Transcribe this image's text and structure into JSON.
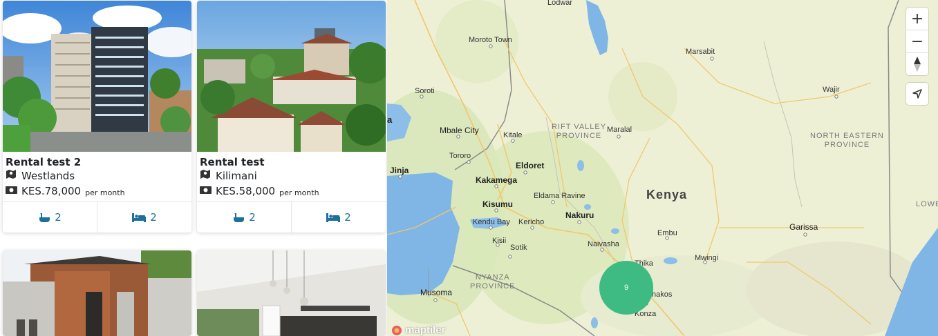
{
  "listings": [
    {
      "title": "Rental test 2",
      "location": "Westlands",
      "price": "KES.78,000",
      "period": "per month",
      "bathrooms": "2",
      "bedrooms": "2"
    },
    {
      "title": "Rental test",
      "location": "Kilimani",
      "price": "KES.58,000",
      "period": "per month",
      "bathrooms": "2",
      "bedrooms": "2"
    }
  ],
  "map": {
    "labels": {
      "lodwar": "Lodwar",
      "moroto": "Moroto Town",
      "marsabit": "Marsabit",
      "soroti": "Soroti",
      "wajir": "Wajir",
      "mbale": "Mbale City",
      "kitale": "Kitale",
      "maralal": "Maralal",
      "rift": "RIFT VALLEY",
      "rift2": "PROVINCE",
      "ne": "NORTH EASTERN",
      "ne2": "PROVINCE",
      "tororo": "Tororo",
      "jinja": "Jinja",
      "eldoret": "Eldoret",
      "kakamega": "Kakamega",
      "eldama": "Eldama Ravine",
      "kenya": "Kenya",
      "lowe": "LOWE",
      "kisumu": "Kisumu",
      "kendu": "Kendu Bay",
      "kericho": "Kericho",
      "nakuru": "Nakuru",
      "garissa": "Garissa",
      "embu": "Embu",
      "kisii": "Kisii",
      "sotik": "Sotik",
      "naivasha": "Naivasha",
      "thika": "Thika",
      "mwingi": "Mwingi",
      "nyanza": "NYANZA",
      "nyanza2": "PROVINCE",
      "musoma": "Musoma",
      "machakos": "hakos",
      "konza": "Konza",
      "ja": "a"
    },
    "cluster_count": "9",
    "attribution": "maptiler",
    "zoom_in": "+",
    "zoom_out": "−"
  }
}
